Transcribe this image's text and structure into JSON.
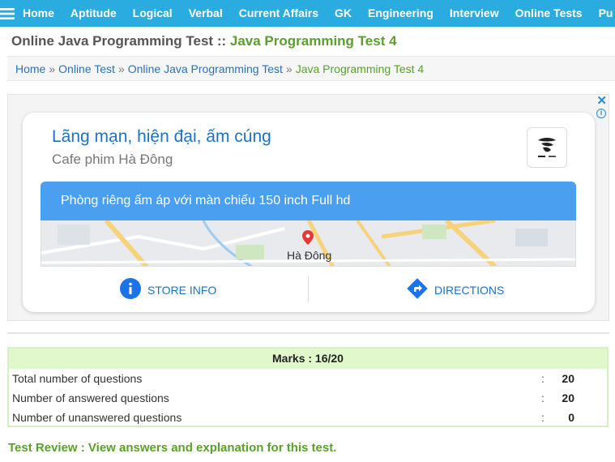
{
  "nav": {
    "items": [
      "Home",
      "Aptitude",
      "Logical",
      "Verbal",
      "Current Affairs",
      "GK",
      "Engineering",
      "Interview",
      "Online Tests",
      "Pu"
    ]
  },
  "heading": {
    "main": "Online Java Programming Test",
    "separator": " :: ",
    "sub": "Java Programming Test 4"
  },
  "breadcrumb": {
    "items": [
      "Home",
      "Online Test",
      "Online Java Programming Test"
    ],
    "separator": "»",
    "current": "Java Programming Test 4"
  },
  "ad": {
    "close": "✕",
    "info": "i",
    "title": "Lãng mạn, hiện đại, ấm cúng",
    "subtitle": "Cafe phim Hà Đông",
    "banner": "Phòng riêng ấm áp với màn chiếu 150 inch Full hd",
    "map_label": "Hà Đông",
    "store_info": "STORE INFO",
    "directions": "DIRECTIONS"
  },
  "result": {
    "marks": "Marks : 16/20",
    "rows": [
      {
        "label": "Total number of questions",
        "colon": ":",
        "value": "20"
      },
      {
        "label": "Number of answered questions",
        "colon": ":",
        "value": "20"
      },
      {
        "label": "Number of unanswered questions",
        "colon": ":",
        "value": "0"
      }
    ]
  },
  "review": "Test Review : View answers and explanation for this test.",
  "colors": {
    "nav_bg": "#2bace1",
    "green": "#5aa02c",
    "link_blue": "#2a71b8",
    "ad_blue": "#4a9ff0"
  }
}
